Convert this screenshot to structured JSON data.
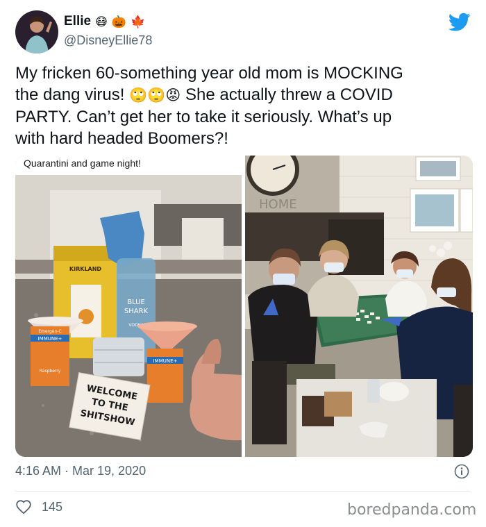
{
  "author": {
    "name": "Ellie",
    "name_emojis": [
      "😷",
      "🎃",
      "🍁"
    ],
    "handle": "@DisneyEllie78"
  },
  "tweet": {
    "line1": "My fricken 60-something year old mom is MOCKING",
    "line2_pre": "the dang virus!",
    "line2_emojis": [
      "🙄",
      "🙄",
      "😡"
    ],
    "line2_post": "She actually threw a COVID",
    "line3": "PARTY. Can’t get her to take it seriously. What’s up",
    "line4": "with hard headed Boomers?!"
  },
  "media": {
    "left_caption": "Quarantini and game night!",
    "left_photo": {
      "box_brand": "KIRKLAND",
      "bottle_label_line1": "BLUE",
      "bottle_label_line2": "SHARK",
      "bottle_label_line3": "VODKA",
      "packet_brand": "Emergen-C",
      "packet_label": "IMMUNE+",
      "packet_flavor_left": "Raspberry",
      "coaster_line1": "WELCOME",
      "coaster_line2": "TO THE",
      "coaster_line3": "SHITSHOW"
    },
    "right_photo": {
      "wall_letters": "HOME"
    }
  },
  "footer": {
    "timestamp": "4:16 AM · Mar 19, 2020",
    "likes": "145",
    "watermark": "boredpanda.com"
  },
  "colors": {
    "twitter_blue": "#1d9bf0",
    "text": "#0f1419",
    "muted": "#536471"
  },
  "icons": [
    "twitter-bird-icon",
    "info-icon",
    "heart-icon"
  ]
}
